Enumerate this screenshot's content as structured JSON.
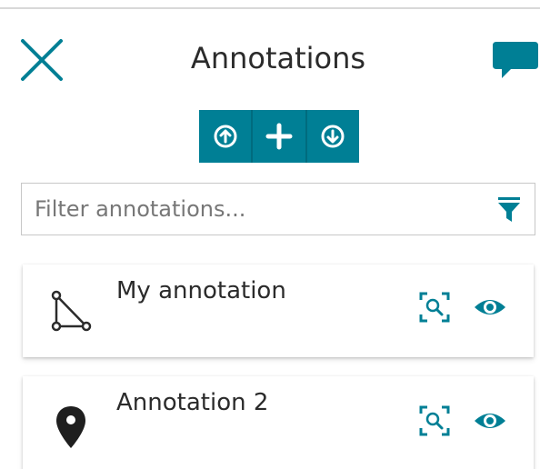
{
  "header": {
    "title": "Annotations",
    "close_icon": "close-icon",
    "chat_icon": "chat-bubble-icon"
  },
  "toolbar": {
    "buttons": [
      {
        "icon": "upload-arrow-icon"
      },
      {
        "icon": "plus-icon"
      },
      {
        "icon": "download-arrow-icon"
      }
    ]
  },
  "filter": {
    "value": "",
    "placeholder": "Filter annotations...",
    "icon": "filter-funnel-icon"
  },
  "annotations": [
    {
      "label": "My annotation",
      "type_icon": "polygon-icon",
      "actions": [
        "zoom-to-icon",
        "eye-icon"
      ]
    },
    {
      "label": "Annotation 2",
      "type_icon": "map-pin-icon",
      "actions": [
        "zoom-to-icon",
        "eye-icon"
      ]
    }
  ],
  "colors": {
    "accent": "#007f95",
    "text": "#2b2b2b",
    "placeholder": "#777777"
  }
}
